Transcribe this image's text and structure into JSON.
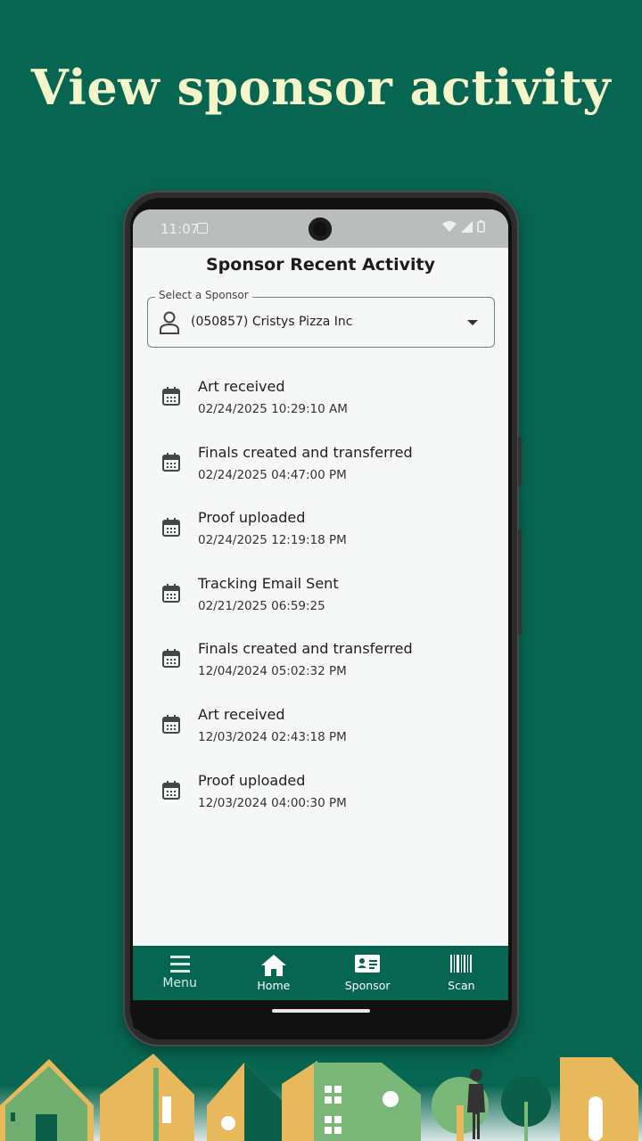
{
  "headline": "View sponsor activity",
  "status_bar": {
    "time": "11:07"
  },
  "app": {
    "title": "Sponsor Recent Activity",
    "sponsor_select": {
      "label": "Select a Sponsor",
      "value": "(050857) Cristys Pizza Inc"
    }
  },
  "activities": [
    {
      "title": "Art received",
      "date": "02/24/2025 10:29:10 AM"
    },
    {
      "title": "Finals created and transferred",
      "date": "02/24/2025 04:47:00 PM"
    },
    {
      "title": "Proof uploaded",
      "date": "02/24/2025 12:19:18 PM"
    },
    {
      "title": "Tracking Email Sent",
      "date": "02/21/2025 06:59:25"
    },
    {
      "title": "Finals created and transferred",
      "date": "12/04/2024 05:02:32 PM"
    },
    {
      "title": "Art received",
      "date": "12/03/2024 02:43:18 PM"
    },
    {
      "title": "Proof uploaded",
      "date": "12/03/2024 04:00:30 PM"
    }
  ],
  "bottom_nav": [
    {
      "label": "Menu",
      "icon": "menu-icon"
    },
    {
      "label": "Home",
      "icon": "home-icon"
    },
    {
      "label": "Sponsor",
      "icon": "id-card-icon"
    },
    {
      "label": "Scan",
      "icon": "barcode-icon"
    }
  ],
  "colors": {
    "background": "#076651",
    "headline": "#f4f5c8",
    "nav_bar": "#076651"
  }
}
